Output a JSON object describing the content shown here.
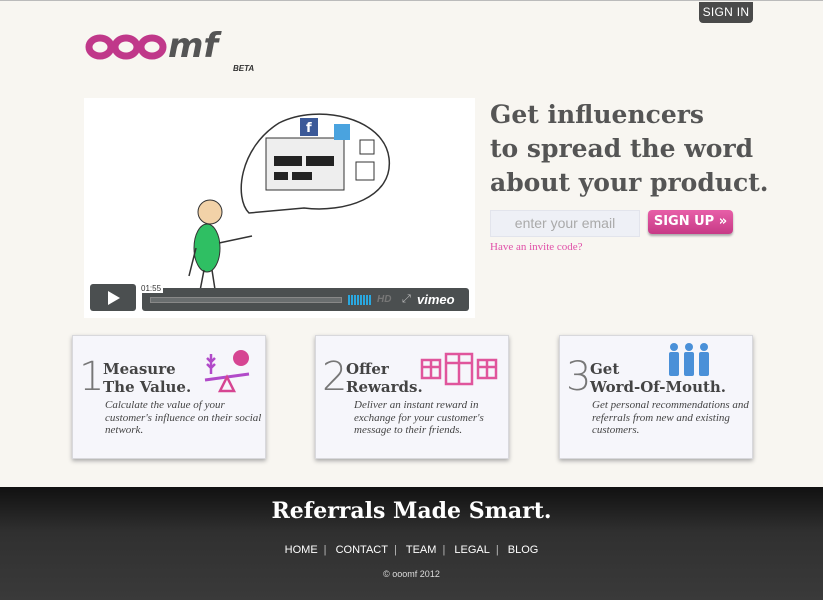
{
  "header": {
    "signin_label": "SIGN IN"
  },
  "logo": {
    "text": "ooomf",
    "beta": "BETA"
  },
  "video": {
    "timecode": "01:55",
    "hd_label": "HD",
    "brand": "vimeo"
  },
  "hero": {
    "headline_line1": "Get influencers",
    "headline_line2": "to spread the word",
    "headline_line3": "about your product.",
    "email_placeholder": "enter your email",
    "signup_label": "SIGN UP »",
    "invite_link": "Have an invite code?"
  },
  "features": [
    {
      "number": "1",
      "title_line1": "Measure",
      "title_line2": "The Value.",
      "description": "Calculate the value of your customer's influence on their social network."
    },
    {
      "number": "2",
      "title_line1": "Offer",
      "title_line2": "Rewards.",
      "description": "Deliver an instant reward in exchange for your customer's message to their friends."
    },
    {
      "number": "3",
      "title_line1": "Get",
      "title_line2": "Word-Of-Mouth.",
      "description": "Get personal recommendations and referrals from new and existing customers."
    }
  ],
  "footer": {
    "tagline": "Referrals Made Smart.",
    "nav": [
      "HOME",
      "CONTACT",
      "TEAM",
      "LEGAL",
      "BLOG"
    ],
    "copyright": "© ooomf 2012"
  },
  "colors": {
    "accent_pink": "#d64592",
    "footer_dark": "#2a2a2a",
    "headline_gray": "#555555",
    "icon_blue": "#4a90d8"
  }
}
